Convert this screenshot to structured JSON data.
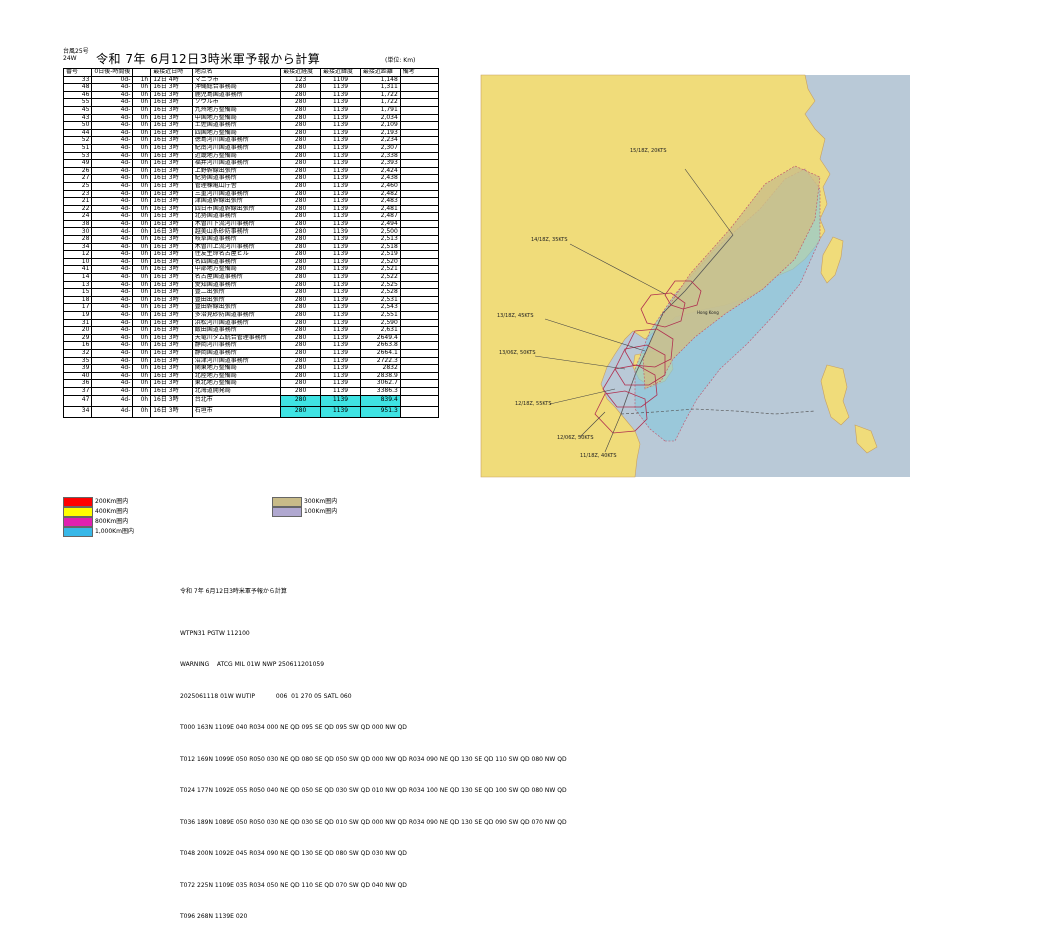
{
  "header": {
    "small_label": "台風25号 24W",
    "title": "令和 7年 6月12日3時米軍予報から計算",
    "unit": "(単位: Km)"
  },
  "table": {
    "headers": [
      "番号",
      "0日後-時間後",
      "",
      "最接近日時",
      "地点名",
      "最接近経度",
      "最接近緯度",
      "最接近距離",
      "備考"
    ],
    "rows": [
      [
        "33",
        "0d-",
        "1h",
        "12日 4時",
        "マニラ市",
        "123",
        "1109",
        "1,148",
        ""
      ],
      [
        "48",
        "4d-",
        "0h",
        "16日 3時",
        "沖縄総合事務局",
        "280",
        "1139",
        "1,311",
        ""
      ],
      [
        "46",
        "4d-",
        "0h",
        "16日 3時",
        "鹿児島国道事務所",
        "280",
        "1139",
        "1,722",
        ""
      ],
      [
        "55",
        "4d-",
        "0h",
        "16日 3時",
        "ソウル市",
        "280",
        "1139",
        "1,722",
        ""
      ],
      [
        "45",
        "4d-",
        "0h",
        "16日 3時",
        "九州地方整備局",
        "280",
        "1139",
        "1,791",
        ""
      ],
      [
        "43",
        "4d-",
        "0h",
        "16日 3時",
        "中国地方整備局",
        "280",
        "1139",
        "2,034",
        ""
      ],
      [
        "50",
        "4d-",
        "0h",
        "16日 3時",
        "土佐国道事務所",
        "280",
        "1139",
        "2,109",
        ""
      ],
      [
        "44",
        "4d-",
        "0h",
        "16日 3時",
        "四国地方整備局",
        "280",
        "1139",
        "2,193",
        ""
      ],
      [
        "52",
        "4d-",
        "0h",
        "16日 3時",
        "徳島河川国道事務所",
        "280",
        "1139",
        "2,234",
        ""
      ],
      [
        "51",
        "4d-",
        "0h",
        "16日 3時",
        "紀南河川国道事務所",
        "280",
        "1139",
        "2,307",
        ""
      ],
      [
        "53",
        "4d-",
        "0h",
        "16日 3時",
        "近畿地方整備局",
        "280",
        "1139",
        "2,338",
        ""
      ],
      [
        "49",
        "4d-",
        "0h",
        "16日 3時",
        "福井河川国道事務所",
        "280",
        "1139",
        "2,393",
        ""
      ],
      [
        "26",
        "4d-",
        "0h",
        "16日 3時",
        "上野幹線出張所",
        "280",
        "1139",
        "2,424",
        ""
      ],
      [
        "27",
        "4d-",
        "0h",
        "16日 3時",
        "紀勢国道事務所",
        "280",
        "1139",
        "2,438",
        ""
      ],
      [
        "25",
        "4d-",
        "0h",
        "16日 3時",
        "管理棟亀山庁舎",
        "280",
        "1139",
        "2,460",
        ""
      ],
      [
        "23",
        "4d-",
        "0h",
        "16日 3時",
        "三重河川国道事務所",
        "280",
        "1139",
        "2,482",
        ""
      ],
      [
        "21",
        "4d-",
        "0h",
        "16日 3時",
        "津国道幹線出張所",
        "280",
        "1139",
        "2,483",
        ""
      ],
      [
        "22",
        "4d-",
        "0h",
        "16日 3時",
        "四日市国道幹線出張所",
        "280",
        "1139",
        "2,481",
        ""
      ],
      [
        "24",
        "4d-",
        "0h",
        "16日 3時",
        "北勢国道事務所",
        "280",
        "1139",
        "2,487",
        ""
      ],
      [
        "38",
        "4d-",
        "0h",
        "16日 3時",
        "木曽川下流河川事務所",
        "280",
        "1139",
        "2,494",
        ""
      ],
      [
        "30",
        "4d-",
        "0h",
        "16日 3時",
        "越美山系砂防事務所",
        "280",
        "1139",
        "2,500",
        ""
      ],
      [
        "28",
        "4d-",
        "0h",
        "16日 3時",
        "岐阜国道事務所",
        "280",
        "1139",
        "2,513",
        ""
      ],
      [
        "34",
        "4d-",
        "0h",
        "16日 3時",
        "木曽川上流河川事務所",
        "280",
        "1139",
        "2,518",
        ""
      ],
      [
        "12",
        "4d-",
        "0h",
        "16日 3時",
        "住友生命名古屋ビル",
        "280",
        "1139",
        "2,519",
        ""
      ],
      [
        "10",
        "4d-",
        "0h",
        "16日 3時",
        "名四国道事務所",
        "280",
        "1139",
        "2,520",
        ""
      ],
      [
        "41",
        "4d-",
        "0h",
        "16日 3時",
        "中部地方整備局",
        "280",
        "1139",
        "2,521",
        ""
      ],
      [
        "14",
        "4d-",
        "0h",
        "16日 3時",
        "名古屋国道事務所",
        "280",
        "1139",
        "2,522",
        ""
      ],
      [
        "13",
        "4d-",
        "0h",
        "16日 3時",
        "愛知国道事務所",
        "280",
        "1139",
        "2,525",
        ""
      ],
      [
        "15",
        "4d-",
        "0h",
        "16日 3時",
        "豊二出張所",
        "280",
        "1139",
        "2,528",
        ""
      ],
      [
        "18",
        "4d-",
        "0h",
        "16日 3時",
        "豊田出張所",
        "280",
        "1139",
        "2,531",
        ""
      ],
      [
        "17",
        "4d-",
        "0h",
        "16日 3時",
        "豊田幹線出張所",
        "280",
        "1139",
        "2,543",
        ""
      ],
      [
        "19",
        "4d-",
        "0h",
        "16日 3時",
        "多治見砂防国道事務所",
        "280",
        "1139",
        "2,551",
        ""
      ],
      [
        "31",
        "4d-",
        "0h",
        "16日 3時",
        "浜松河川国道事務所",
        "280",
        "1139",
        "2,590",
        ""
      ],
      [
        "20",
        "4d-",
        "0h",
        "16日 3時",
        "飯田国道事務所",
        "280",
        "1139",
        "2,631",
        ""
      ],
      [
        "29",
        "4d-",
        "0h",
        "16日 3時",
        "天竜川ダム統合管理事務所",
        "280",
        "1139",
        "2649.4",
        ""
      ],
      [
        "16",
        "4d-",
        "0h",
        "16日 3時",
        "静岡河川事務所",
        "280",
        "1139",
        "2663.8",
        ""
      ],
      [
        "32",
        "4d-",
        "0h",
        "16日 3時",
        "静岡国道事務所",
        "280",
        "1139",
        "2664.1",
        ""
      ],
      [
        "35",
        "4d-",
        "0h",
        "16日 3時",
        "沼津河川国道事務所",
        "280",
        "1139",
        "2722.3",
        ""
      ],
      [
        "39",
        "4d-",
        "0h",
        "16日 3時",
        "関東地方整備局",
        "280",
        "1139",
        "2832",
        ""
      ],
      [
        "40",
        "4d-",
        "0h",
        "16日 3時",
        "北陸地方整備局",
        "280",
        "1139",
        "2838.9",
        ""
      ],
      [
        "36",
        "4d-",
        "0h",
        "16日 3時",
        "東北地方整備局",
        "280",
        "1139",
        "3062.7",
        ""
      ],
      [
        "37",
        "4d-",
        "0h",
        "16日 3時",
        "北海道開発局",
        "280",
        "1139",
        "3386.3",
        ""
      ]
    ],
    "extra_rows": [
      [
        "47",
        "4d-",
        "0h",
        "16日 3時",
        "台北市",
        "280",
        "1139",
        "839.4",
        ""
      ],
      [
        "34",
        "4d-",
        "0h",
        "16日 3時",
        "石垣市",
        "280",
        "1139",
        "951.3",
        ""
      ]
    ]
  },
  "legend_left": [
    {
      "color": "#ff0000",
      "label": "200Km圏内"
    },
    {
      "color": "#ffff00",
      "label": "400Km圏内"
    },
    {
      "color": "#e020b0",
      "label": "800Km圏内"
    },
    {
      "color": "#38b8e8",
      "label": "1,000Km圏内"
    }
  ],
  "legend_right": [
    {
      "color": "#c8bb88",
      "label": "300Km圏内"
    },
    {
      "color": "#b0a8d0",
      "label": "100Km圏内"
    }
  ],
  "map": {
    "labels": [
      "15/18Z, 20KTS",
      "14/18Z, 35KTS",
      "13/18Z, 45KTS",
      "13/06Z, 50KTS",
      "12/18Z, 55KTS",
      "12/06Z, 50KTS",
      "11/18Z, 40KTS",
      "Hong Kong"
    ],
    "colors": {
      "land": "#f0dc7a",
      "sea": "#b9c9d7",
      "cone": "#cdbf88",
      "cone_outer": "#88c8dc",
      "track": "#b03050"
    }
  },
  "message": {
    "title": "令和 7年 6月12日3時米軍予報から計算",
    "lines": [
      "WTPN31 PGTW 112100",
      "WARNING    ATCG MIL 01W NWP 250611201059",
      "2025061118 01W WUTIP           006  01 270 05 SATL 060",
      "T000 163N 1109E 040 R034 000 NE QD 095 SE QD 095 SW QD 000 NW QD",
      "T012 169N 1099E 050 R050 030 NE QD 080 SE QD 050 SW QD 000 NW QD R034 090 NE QD 130 SE QD 110 SW QD 080 NW QD",
      "T024 177N 1092E 055 R050 040 NE QD 050 SE QD 030 SW QD 010 NW QD R034 100 NE QD 130 SE QD 100 SW QD 080 NW QD",
      "T036 189N 1089E 050 R050 030 NE QD 030 SE QD 010 SW QD 000 NW QD R034 090 NE QD 130 SE QD 090 SW QD 070 NW QD",
      "T048 200N 1092E 045 R034 090 NE QD 130 SE QD 080 SW QD 030 NW QD",
      "T072 225N 1109E 035 R034 050 NE QD 110 SE QD 070 SW QD 040 NW QD",
      "T096 268N 1139E 020"
    ]
  }
}
